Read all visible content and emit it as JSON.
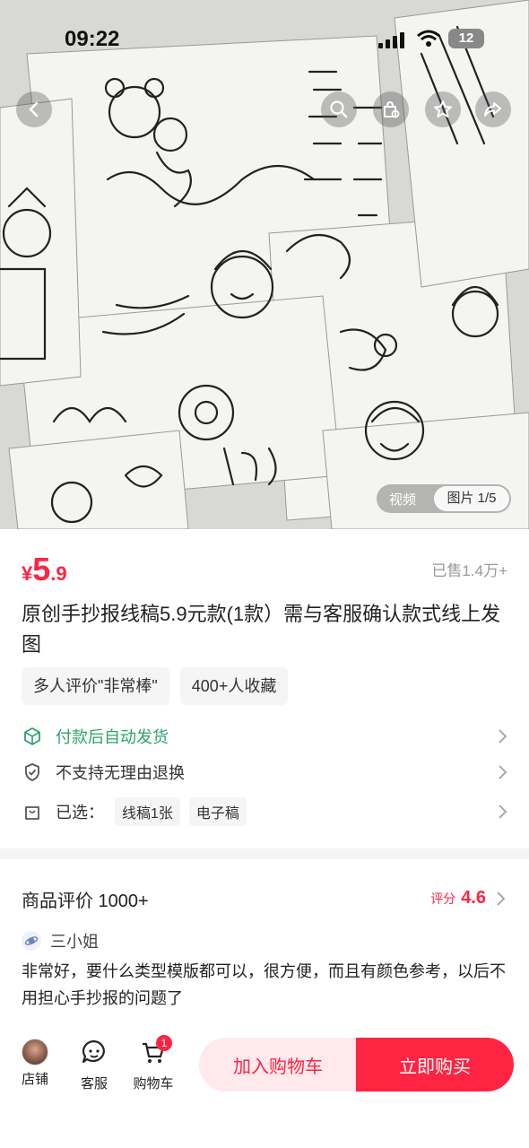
{
  "status_bar": {
    "time": "09:22",
    "battery": "12"
  },
  "hero": {
    "video_tab": "视频",
    "image_tab": "图片 1/5"
  },
  "product": {
    "currency": "¥",
    "price_int": "5",
    "price_dec": ".9",
    "sold": "已售1.4万+",
    "title": "原创手抄报线稿5.9元款(1款）需与客服确认款式线上发图",
    "chips": [
      "多人评价\"非常棒\"",
      "400+人收藏"
    ],
    "delivery": "付款后自动发货",
    "return_policy": "不支持无理由退换",
    "selected_label": "已选：",
    "selected_options": [
      "线稿1张",
      "电子稿"
    ]
  },
  "reviews": {
    "title": "商品评价 1000+",
    "score_label": "评分",
    "score": "4.6",
    "reviewer": "三小姐",
    "text": "非常好，要什么类型模版都可以，很方便，而且有颜色参考，以后不用担心手抄报的问题了"
  },
  "bottom_bar": {
    "shop": "店铺",
    "customer_service": "客服",
    "cart": "购物车",
    "cart_count": "1",
    "add_to_cart": "加入购物车",
    "buy_now": "立即购买"
  },
  "colors": {
    "accent": "#ff2442",
    "delivery_green": "#2aa36b"
  }
}
